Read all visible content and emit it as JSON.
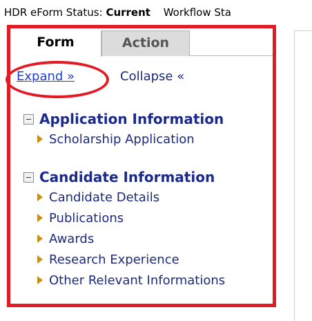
{
  "status": {
    "label": "HDR eForm Status:",
    "value": "Current",
    "workflow_label": "Workflow Sta"
  },
  "tabs": [
    {
      "label": "Form",
      "active": true
    },
    {
      "label": "Action",
      "active": false
    }
  ],
  "tree_controls": {
    "expand": "Expand »",
    "collapse": "Collapse «"
  },
  "sections": [
    {
      "title": "Application Information",
      "expanded": true,
      "items": [
        "Scholarship Application"
      ]
    },
    {
      "title": "Candidate Information",
      "expanded": true,
      "items": [
        "Candidate Details",
        "Publications",
        "Awards",
        "Research Experience",
        "Other Relevant Informations"
      ]
    }
  ],
  "colors": {
    "highlight": "#e21a24",
    "section_title": "#1b2a8a",
    "link": "#1d3fd6",
    "arrow": "#c8901a"
  }
}
